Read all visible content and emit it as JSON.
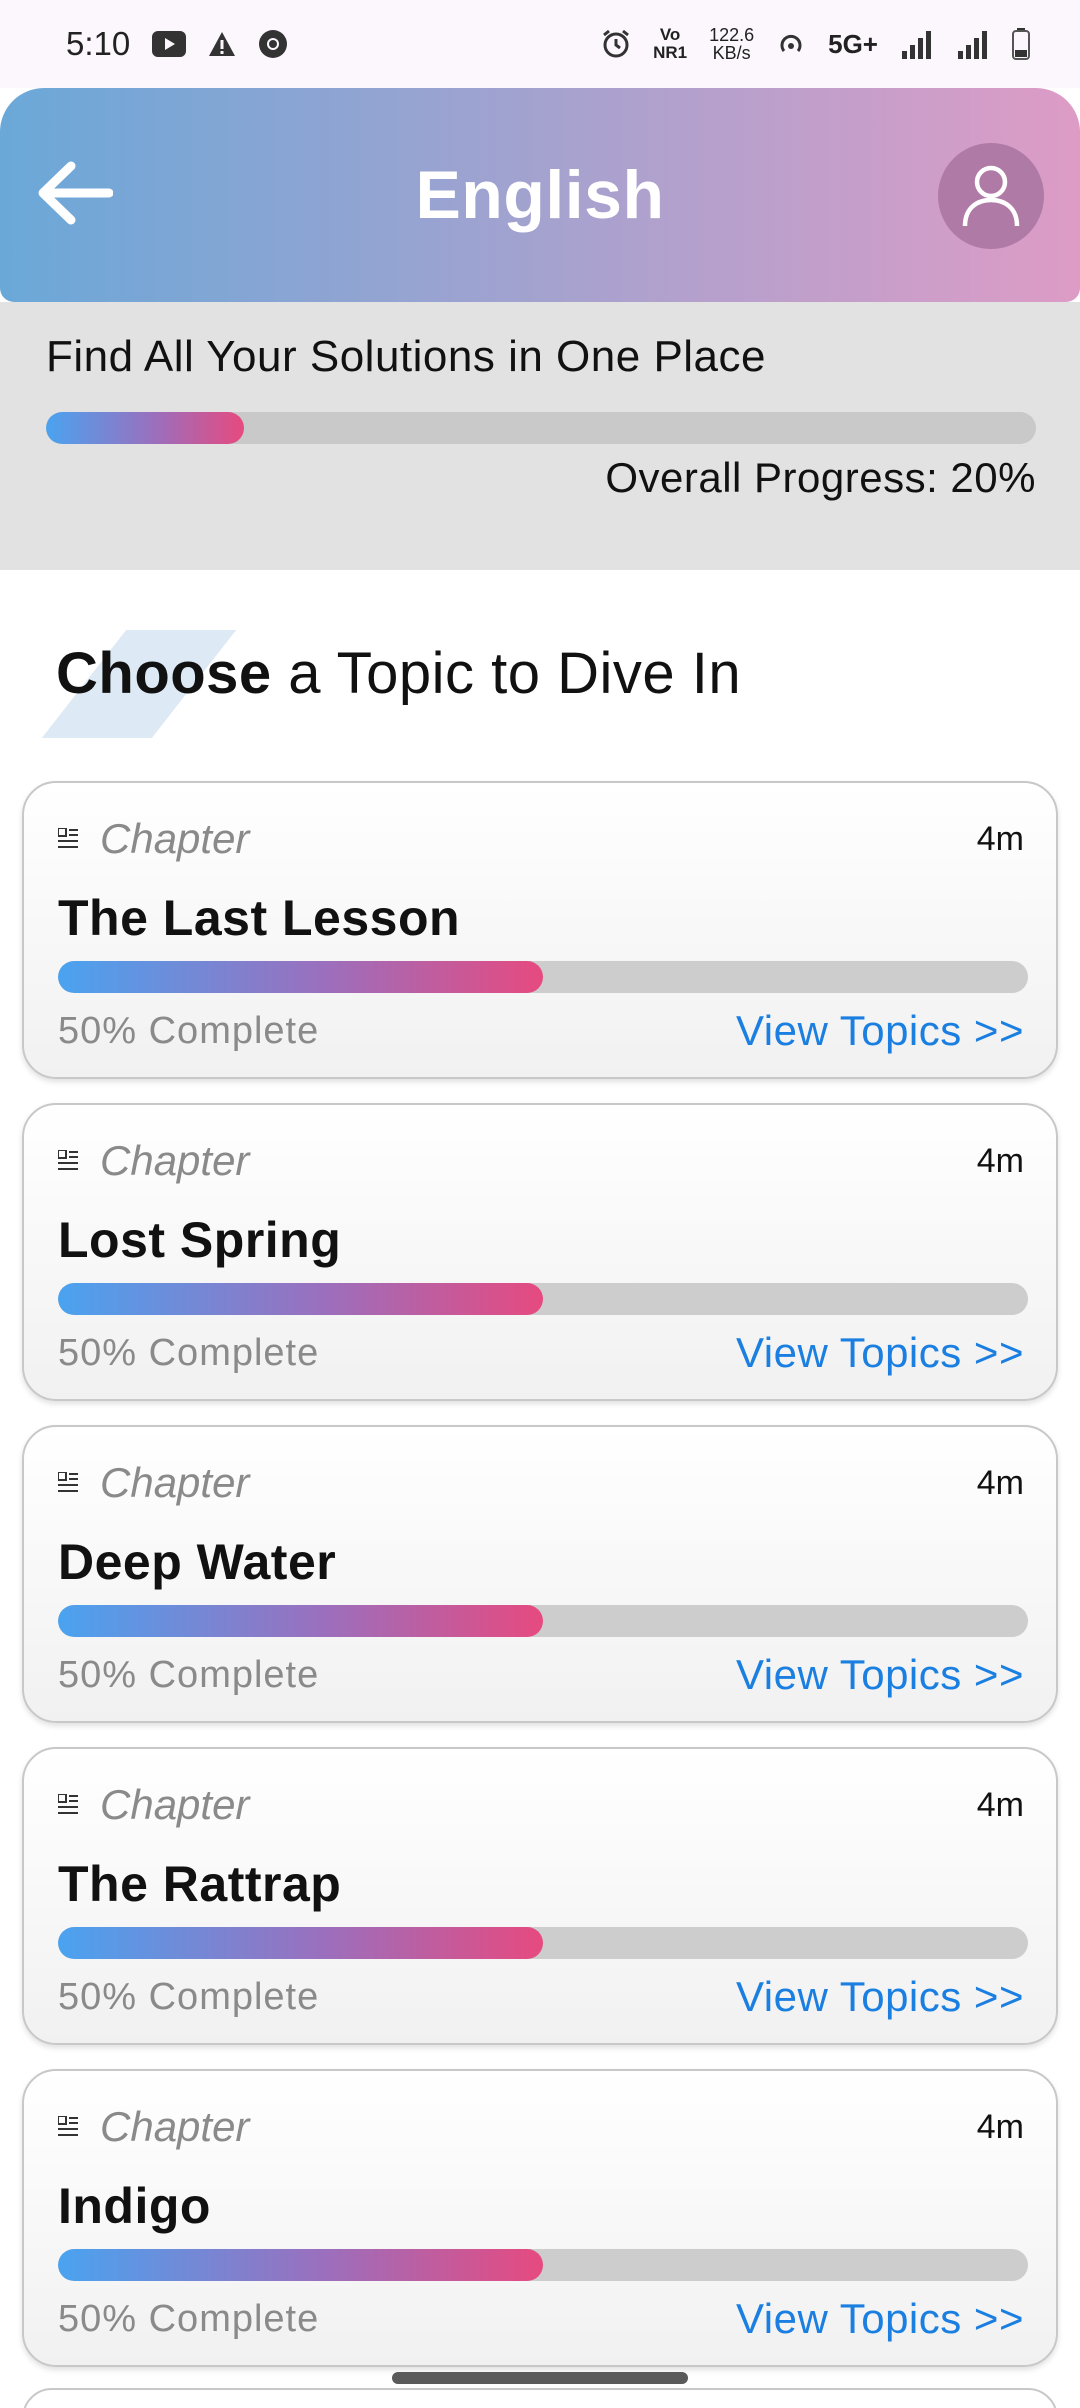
{
  "status_bar": {
    "time": "5:10",
    "network_speed_top": "122.6",
    "network_speed_bottom": "KB/s",
    "volte_top": "Vo",
    "volte_bottom": "NR1",
    "network_type": "5G+"
  },
  "header": {
    "title": "English",
    "back_icon": "arrow-left-icon",
    "profile_icon": "person-icon"
  },
  "progress_panel": {
    "heading": "Find All Your Solutions in One Place",
    "overall_label": "Overall Progress: 20%",
    "overall_progress": 0.2
  },
  "section": {
    "title_bold": "Choose",
    "title_rest": " a Topic to Dive In"
  },
  "colors": {
    "accent_link": "#1a7fe0",
    "progress_start": "#4aa3f0",
    "progress_end": "#e64a7f",
    "header_start": "#6aa8d8",
    "header_end": "#dd9cc6"
  },
  "chapters": [
    {
      "tag": "Chapter",
      "duration": "4m",
      "title": "The Last Lesson",
      "progress": 0.5,
      "complete_label": "50% Complete",
      "link_label": "View Topics >>"
    },
    {
      "tag": "Chapter",
      "duration": "4m",
      "title": "Lost Spring",
      "progress": 0.5,
      "complete_label": "50% Complete",
      "link_label": "View Topics >>"
    },
    {
      "tag": "Chapter",
      "duration": "4m",
      "title": "Deep Water",
      "progress": 0.5,
      "complete_label": "50% Complete",
      "link_label": "View Topics >>"
    },
    {
      "tag": "Chapter",
      "duration": "4m",
      "title": "The Rattrap",
      "progress": 0.5,
      "complete_label": "50% Complete",
      "link_label": "View Topics >>"
    },
    {
      "tag": "Chapter",
      "duration": "4m",
      "title": "Indigo",
      "progress": 0.5,
      "complete_label": "50% Complete",
      "link_label": "View Topics >>"
    }
  ]
}
